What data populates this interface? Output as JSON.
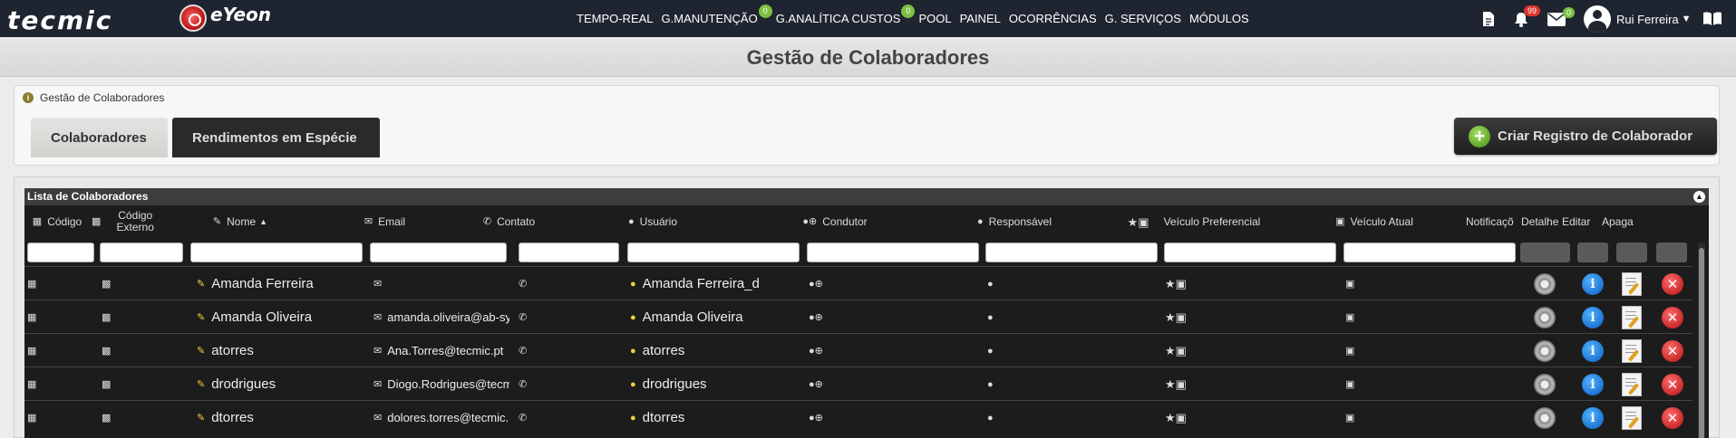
{
  "app": {
    "logo_text": "tecmic",
    "sublogo_text": "eYeon"
  },
  "nav": {
    "items": [
      {
        "label": "TEMPO-REAL"
      },
      {
        "label": "G.MANUTENÇÃO",
        "badge": "0"
      },
      {
        "label": "G.ANALÍTICA CUSTOS",
        "badge": "0"
      },
      {
        "label": "POOL"
      },
      {
        "label": "PAINEL"
      },
      {
        "label": "OCORRÊNCIAS"
      },
      {
        "label": "G. SERVIÇOS"
      },
      {
        "label": "MÓDULOS"
      }
    ]
  },
  "topright": {
    "notifications_badge": "99",
    "messages_badge": "0",
    "user_name": "Rui Ferreira"
  },
  "page": {
    "title": "Gestão de Colaboradores",
    "breadcrumb": "Gestão de Colaboradores"
  },
  "tabs": {
    "active": "Colaboradores",
    "inactive": "Rendimentos em Espécie"
  },
  "actions": {
    "create_label": "Criar Registro de Colaborador"
  },
  "grid": {
    "caption": "Lista de Colaboradores",
    "columns": {
      "codigo": "Código",
      "codigo_externo": "Código Externo",
      "nome": "Nome",
      "email": "Email",
      "contato": "Contato",
      "usuario": "Usuário",
      "condutor": "Condutor",
      "responsavel": "Responsável",
      "veiculo_preferencial": "Veículo Preferencial",
      "veiculo_atual": "Veículo Atual",
      "notificacoes": "Notificaçõ",
      "detalhes": "Detalhe",
      "editar": "Editar",
      "apagar": "Apaga"
    },
    "rows": [
      {
        "nome": "Amanda Ferreira",
        "email": "",
        "usuario": "Amanda Ferreira_d"
      },
      {
        "nome": "Amanda Oliveira",
        "email": "amanda.oliveira@ab-sy",
        "usuario": "Amanda Oliveira"
      },
      {
        "nome": "atorres",
        "email": "Ana.Torres@tecmic.pt",
        "usuario": "atorres"
      },
      {
        "nome": "drodrigues",
        "email": "Diogo.Rodrigues@tecm",
        "usuario": "drodrigues"
      },
      {
        "nome": "dtorres",
        "email": "dolores.torres@tecmic.",
        "usuario": "dtorres"
      }
    ]
  },
  "colors": {
    "topbar": "#1f2530",
    "grid_bg": "#1c1c1c",
    "accent_green": "#7bc043",
    "badge_red": "#d9332e"
  }
}
